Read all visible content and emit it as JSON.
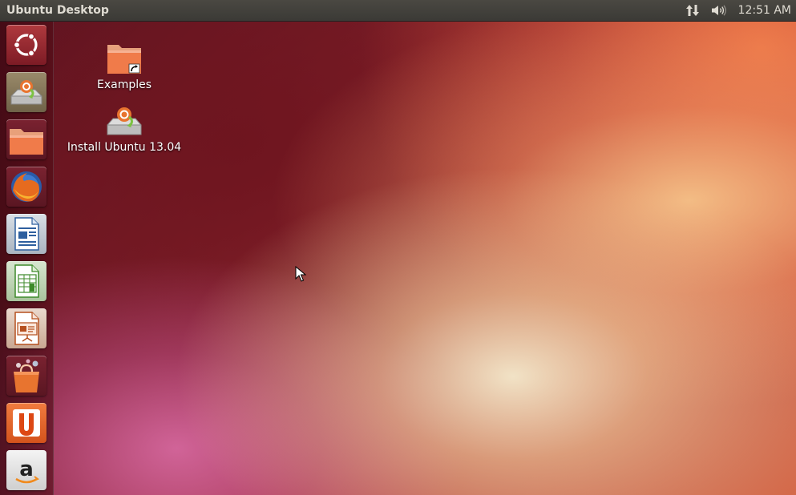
{
  "panel": {
    "title": "Ubuntu Desktop",
    "clock": "12:51 AM",
    "indicators": [
      "network-arrows-icon",
      "volume-icon"
    ]
  },
  "launcher": {
    "items": [
      {
        "name": "dash-home",
        "icon": "ubuntu-logo-icon"
      },
      {
        "name": "install-ubuntu",
        "icon": "installer-disk-icon"
      },
      {
        "name": "files",
        "icon": "folder-icon"
      },
      {
        "name": "firefox",
        "icon": "firefox-icon"
      },
      {
        "name": "libreoffice-writer",
        "icon": "writer-icon"
      },
      {
        "name": "libreoffice-calc",
        "icon": "calc-icon"
      },
      {
        "name": "libreoffice-impress",
        "icon": "impress-icon"
      },
      {
        "name": "ubuntu-software-center",
        "icon": "shopping-bag-icon"
      },
      {
        "name": "ubuntu-one",
        "icon": "ubuntu-one-icon"
      },
      {
        "name": "amazon",
        "icon": "amazon-icon"
      }
    ]
  },
  "desktop": {
    "icons": [
      {
        "label": "Examples",
        "icon": "folder-link-icon"
      },
      {
        "label": "Install Ubuntu 13.04",
        "icon": "installer-disk-icon"
      }
    ]
  },
  "colors": {
    "panel_bg": "#3b3a36",
    "panel_text": "#dfdbd2",
    "accent": "#dd4814"
  }
}
